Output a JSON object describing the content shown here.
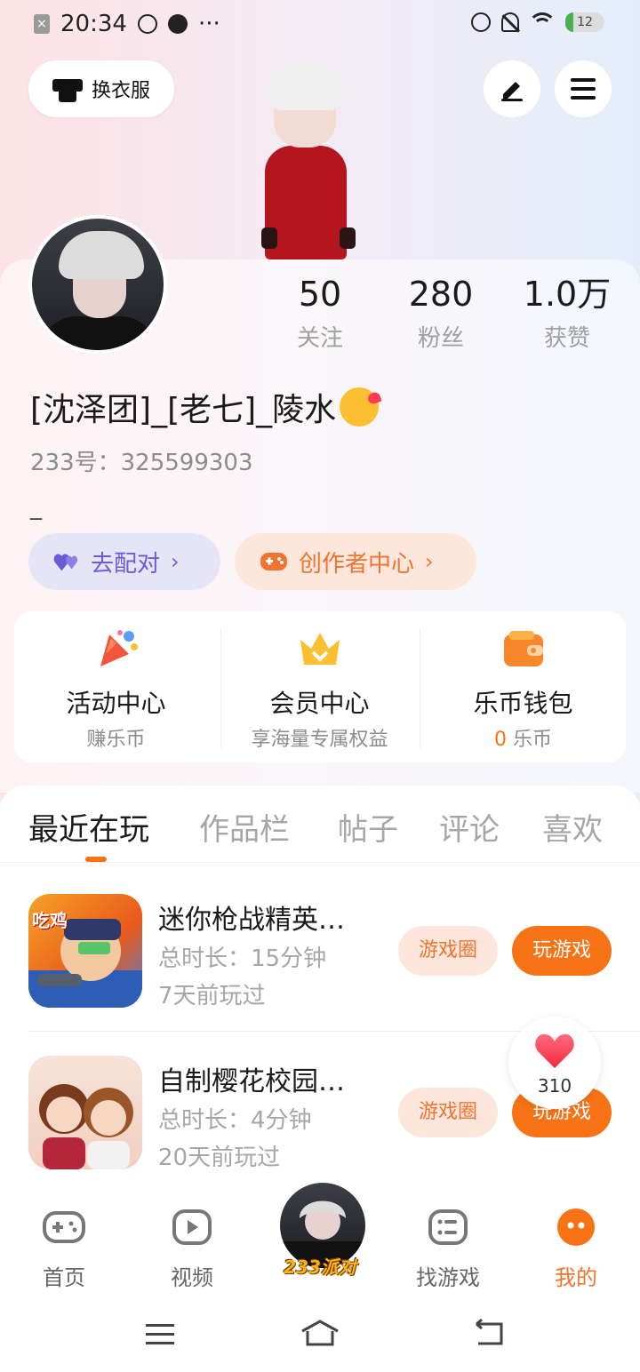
{
  "status_bar": {
    "time": "20:34",
    "dots": "···",
    "battery": "12"
  },
  "header": {
    "dress_label": "换衣服"
  },
  "profile": {
    "stats": [
      {
        "num": "50",
        "label": "关注"
      },
      {
        "num": "280",
        "label": "粉丝"
      },
      {
        "num": "1.0万",
        "label": "获赞"
      }
    ],
    "nickname": "[沈泽团]_[老七]_陵水",
    "uid": "233号：325599303",
    "bio": "_",
    "match_label": "去配对",
    "creator_label": "创作者中心",
    "chevron": "›"
  },
  "quick": {
    "items": [
      {
        "title": "活动中心",
        "sub": "赚乐币"
      },
      {
        "title": "会员中心",
        "sub": "享海量专属权益"
      },
      {
        "title": "乐币钱包",
        "sub_count": "0",
        "sub_unit": " 乐币"
      }
    ]
  },
  "tabs": [
    "最近在玩",
    "作品栏",
    "帖子",
    "评论",
    "喜欢"
  ],
  "games": [
    {
      "title": "迷你枪战精英…",
      "duration": "总时长：15分钟",
      "last": "7天前玩过",
      "circle_label": "游戏圈",
      "play_label": "玩游戏",
      "icon_text": "吃鸡"
    },
    {
      "title": "自制樱花校园…",
      "duration": "总时长：4分钟",
      "last": "20天前玩过",
      "circle_label": "游戏圈",
      "play_label": "玩游戏"
    }
  ],
  "like_float": {
    "count": "310"
  },
  "bottom_nav": {
    "items": [
      "首页",
      "视频",
      "找游戏",
      "我的"
    ],
    "center_label": "233派对"
  },
  "colors": {
    "accent": "#f87316",
    "purple": "#6b5bd6"
  }
}
